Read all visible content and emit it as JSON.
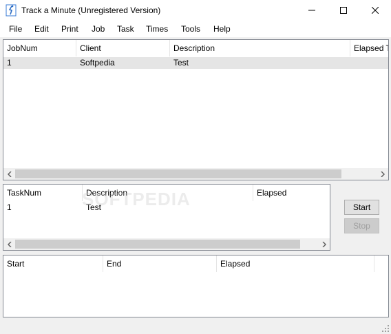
{
  "window": {
    "title": "Track a Minute (Unregistered Version)",
    "app_icon": "figure-icon",
    "controls": [
      "minimize-icon",
      "maximize-icon",
      "close-icon"
    ]
  },
  "menu": [
    "File",
    "Edit",
    "Print",
    "Job",
    "Task",
    "Times",
    "Tools",
    "Help"
  ],
  "jobs": {
    "columns": [
      "JobNum",
      "Client",
      "Description",
      "Elapsed Ti"
    ],
    "rows": [
      {
        "jobnum": "1",
        "client": "Softpedia",
        "description": "Test",
        "elapsed": ""
      }
    ]
  },
  "tasks": {
    "columns": [
      "TaskNum",
      "Description",
      "Elapsed"
    ],
    "rows": [
      {
        "tasknum": "1",
        "description": "Test",
        "elapsed": ""
      }
    ]
  },
  "times": {
    "columns": [
      "Start",
      "End",
      "Elapsed"
    ],
    "rows": []
  },
  "buttons": {
    "start": "Start",
    "stop": "Stop"
  },
  "watermark": "SOFTPEDIA",
  "colors": {
    "selection": "#e5e5e5",
    "border": "#828790",
    "window_bg": "#f0f0f0",
    "scroll_thumb": "#cdcdcd"
  }
}
